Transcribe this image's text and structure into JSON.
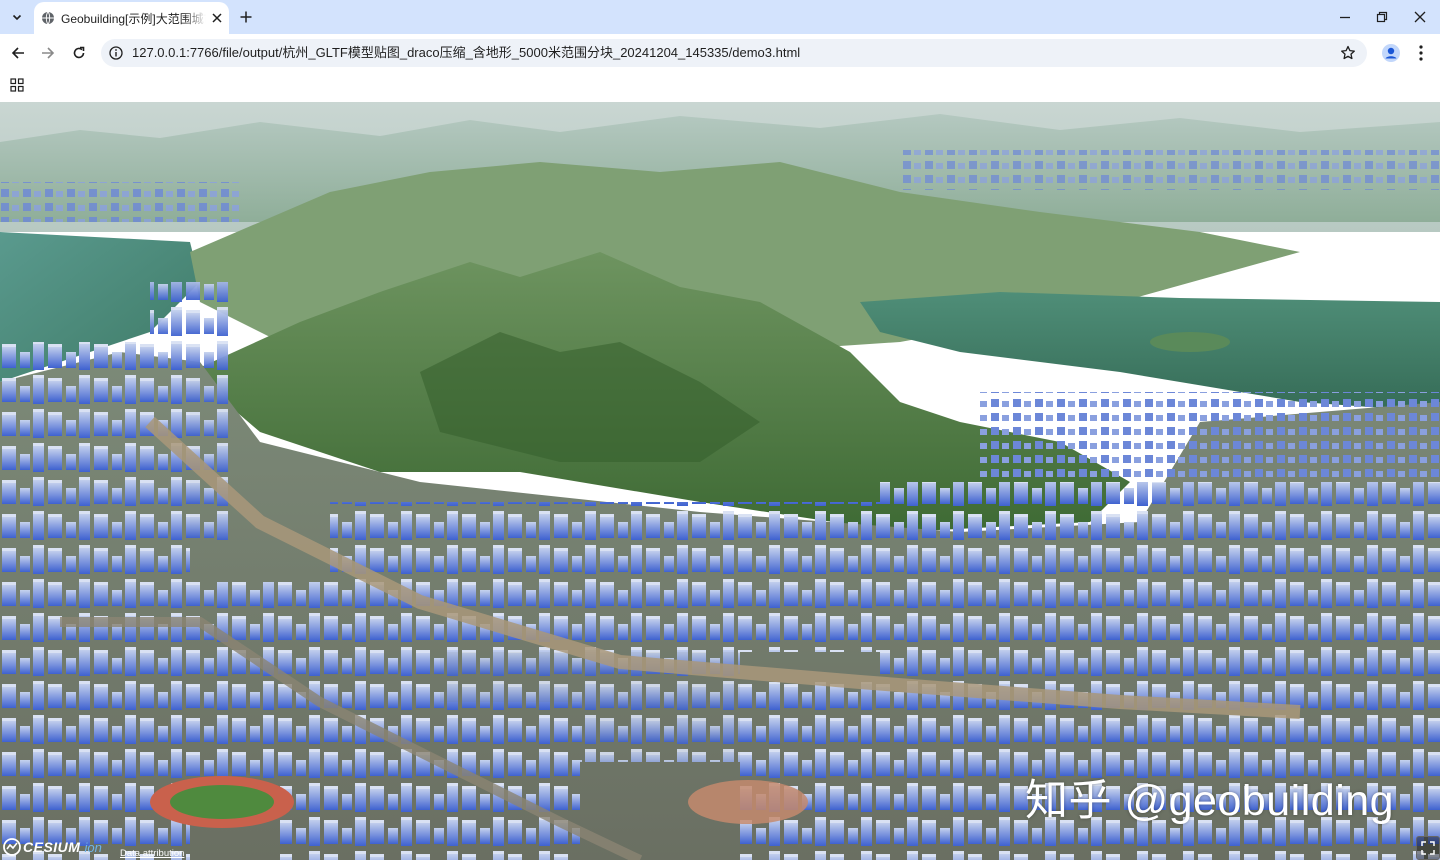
{
  "browser": {
    "tab_title": "Geobuilding[示例]大范围城市",
    "url": "127.0.0.1:7766/file/output/杭州_GLTF模型贴图_draco压缩_含地形_5000米范围分块_20241204_145335/demo3.html",
    "icons": {
      "tab_search": "chevron-down-icon",
      "favicon": "globe-icon",
      "close_tab": "close-icon",
      "new_tab": "plus-icon",
      "minimize": "minimize-icon",
      "restore": "restore-icon",
      "close_window": "close-icon",
      "back": "arrow-left-icon",
      "forward": "arrow-right-icon",
      "reload": "reload-icon",
      "site_info": "info-icon",
      "bookmark": "star-icon",
      "profile": "person-icon",
      "menu": "kebab-icon",
      "apps": "grid-icon"
    }
  },
  "viewer": {
    "logo_brand": "CESIUM",
    "logo_suffix": "ion",
    "attribution_link": "Data attribution",
    "watermark": "知乎 @geobuilding",
    "fullscreen_icon": "fullscreen-icon"
  },
  "colors": {
    "tabstrip": "#d3e3fd",
    "buildings": "#5f7fd8",
    "vegetation": "#4f7a3e",
    "water": "#3f7c72"
  }
}
